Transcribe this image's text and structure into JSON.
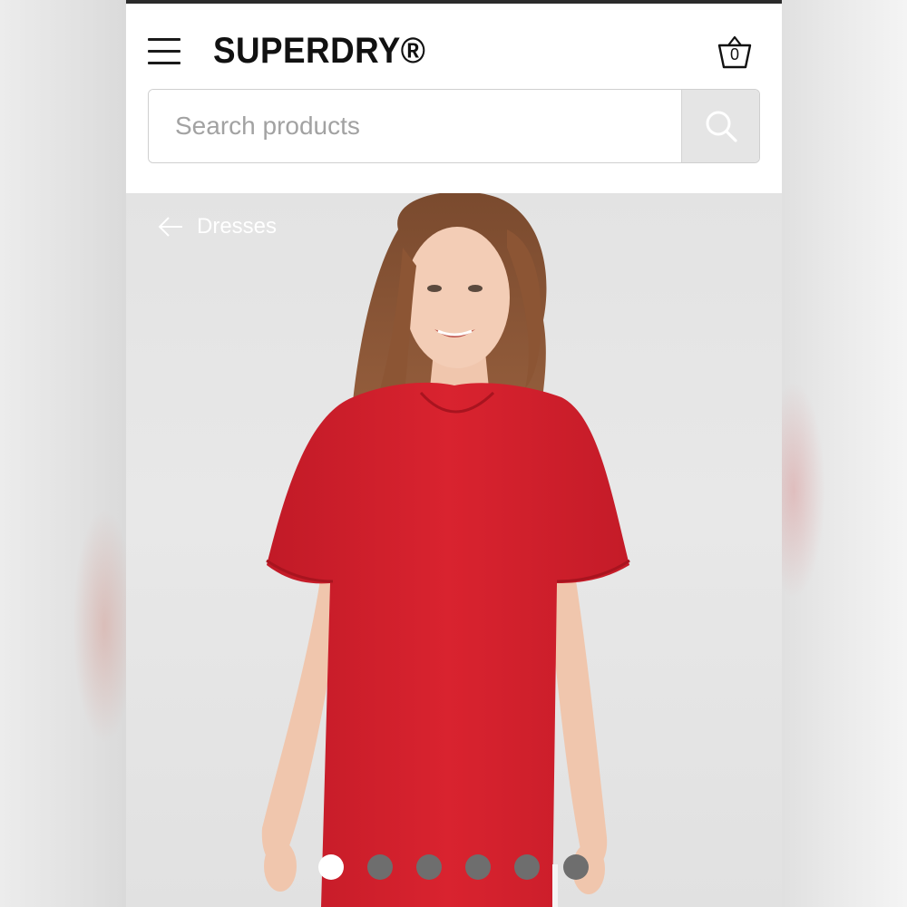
{
  "header": {
    "logo_text": "SUPERDRY®",
    "basket_count": "0"
  },
  "search": {
    "placeholder": "Search products",
    "value": ""
  },
  "breadcrumb": {
    "back_label": "Dresses"
  },
  "carousel": {
    "total_slides": 6,
    "active_index": 0
  },
  "colors": {
    "dress_red": "#d2202d",
    "background_grey": "#e4e4e4",
    "search_button_grey": "#e5e5e5"
  },
  "icons": [
    "menu-icon",
    "basket-icon",
    "search-icon",
    "arrow-left-icon"
  ]
}
